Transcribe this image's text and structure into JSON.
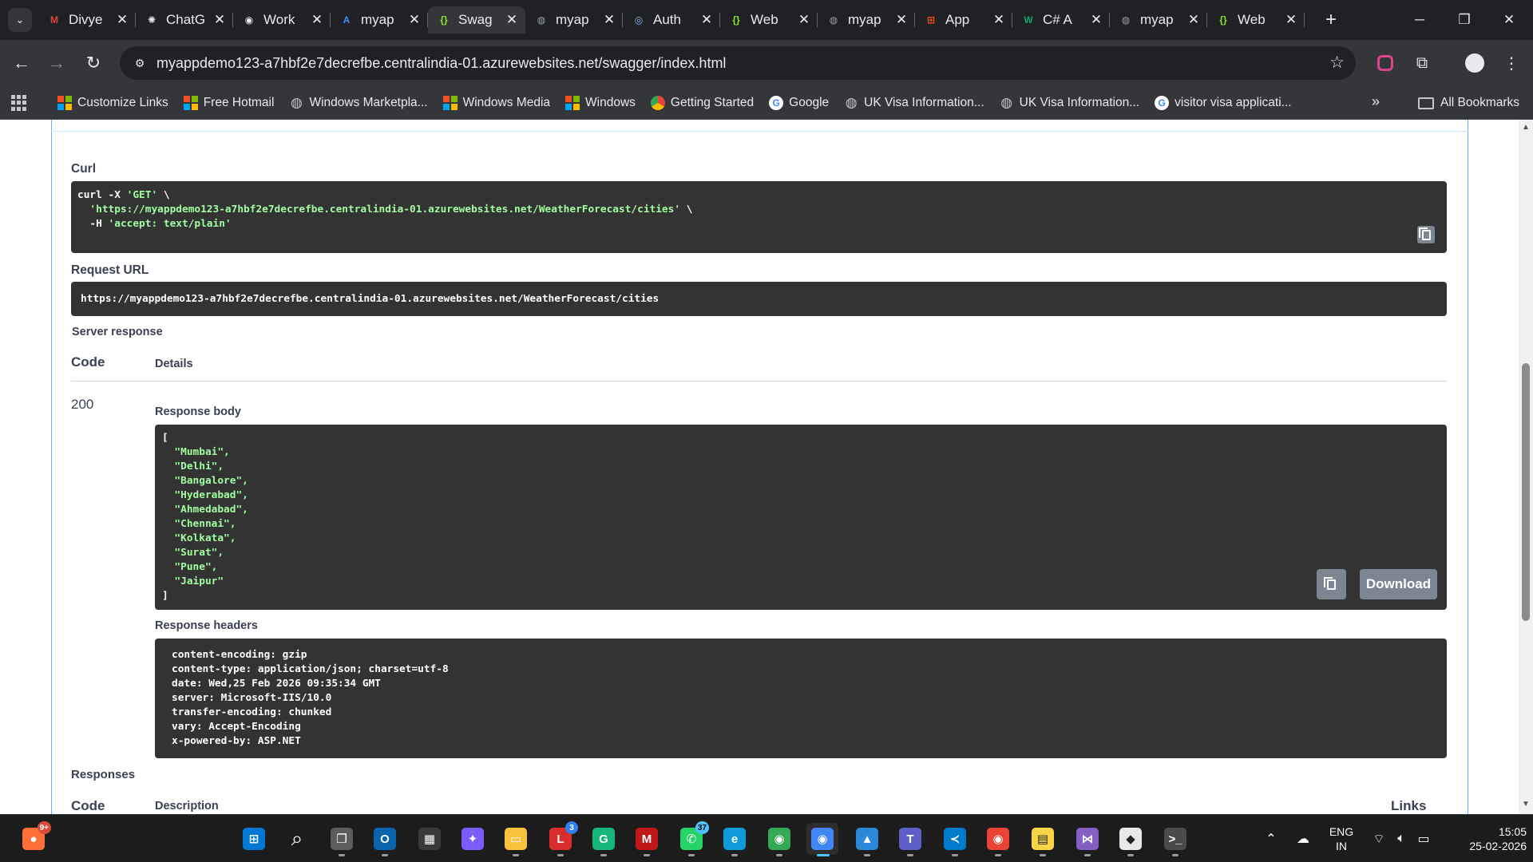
{
  "browser": {
    "tabs": [
      {
        "title": "Divye",
        "icon": "gmail-icon",
        "color": "#ea4335",
        "letter": "M"
      },
      {
        "title": "ChatG",
        "icon": "chatgpt-icon",
        "color": "#e8eaed",
        "letter": "✺"
      },
      {
        "title": "Work",
        "icon": "github-icon",
        "color": "#e8eaed",
        "letter": "◉"
      },
      {
        "title": "myap",
        "icon": "azure-icon",
        "color": "#3c8dff",
        "letter": "A"
      },
      {
        "title": "Swag",
        "icon": "swagger-icon",
        "color": "#85ea2d",
        "letter": "{}",
        "active": true
      },
      {
        "title": "myap",
        "icon": "globe-icon",
        "color": "#9aa0a6",
        "letter": "◍"
      },
      {
        "title": "Auth",
        "icon": "auth-icon",
        "color": "#8ab4f8",
        "letter": "◎"
      },
      {
        "title": "Web",
        "icon": "swagger-icon",
        "color": "#85ea2d",
        "letter": "{}"
      },
      {
        "title": "myap",
        "icon": "globe-icon",
        "color": "#9aa0a6",
        "letter": "◍"
      },
      {
        "title": "App",
        "icon": "microsoft-icon",
        "color": "#f25022",
        "letter": "⊞"
      },
      {
        "title": "C# A",
        "icon": "w3schools-icon",
        "color": "#04aa6d",
        "letter": "W"
      },
      {
        "title": "myap",
        "icon": "globe-icon",
        "color": "#9aa0a6",
        "letter": "◍"
      },
      {
        "title": "Web",
        "icon": "swagger-icon",
        "color": "#85ea2d",
        "letter": "{}"
      }
    ],
    "url": "myappdemo123-a7hbf2e7decrefbe.centralindia-01.azurewebsites.net/swagger/index.html",
    "bookmarks": [
      {
        "label": "Customize Links",
        "icon": "microsoft-icon"
      },
      {
        "label": "Free Hotmail",
        "icon": "microsoft-icon"
      },
      {
        "label": "Windows Marketpla...",
        "icon": "globe-icon"
      },
      {
        "label": "Windows Media",
        "icon": "microsoft-icon"
      },
      {
        "label": "Windows",
        "icon": "microsoft-icon"
      },
      {
        "label": "Getting Started",
        "icon": "chrome-icon"
      },
      {
        "label": "Google",
        "icon": "google-icon"
      },
      {
        "label": "UK Visa Information...",
        "icon": "globe-icon"
      },
      {
        "label": "UK Visa Information...",
        "icon": "globe-icon"
      },
      {
        "label": "visitor visa applicati...",
        "icon": "google-icon"
      }
    ],
    "all_bookmarks_label": "All Bookmarks"
  },
  "swagger": {
    "curl_label": "Curl",
    "curl_lines": [
      {
        "plain": "curl -X ",
        "str": "'GET'",
        "tail": " \\"
      },
      {
        "plain": "  ",
        "str": "'https://myappdemo123-a7hbf2e7decrefbe.centralindia-01.azurewebsites.net/WeatherForecast/cities'",
        "tail": " \\"
      },
      {
        "plain": "  -H ",
        "str": "'accept: text/plain'",
        "tail": ""
      }
    ],
    "request_url_label": "Request URL",
    "request_url": "https://myappdemo123-a7hbf2e7decrefbe.centralindia-01.azurewebsites.net/WeatherForecast/cities",
    "server_response_label": "Server response",
    "code_header": "Code",
    "details_header": "Details",
    "response_code": "200",
    "response_body_label": "Response body",
    "response_body": {
      "open": "[",
      "items": [
        "\"Mumbai\",",
        "\"Delhi\",",
        "\"Bangalore\",",
        "\"Hyderabad\",",
        "\"Ahmedabad\",",
        "\"Chennai\",",
        "\"Kolkata\",",
        "\"Surat\",",
        "\"Pune\",",
        "\"Jaipur\""
      ],
      "close": "]"
    },
    "download_label": "Download",
    "response_headers_label": "Response headers",
    "response_headers": [
      "content-encoding: gzip",
      "content-type: application/json; charset=utf-8",
      "date: Wed,25 Feb 2026 09:35:34 GMT",
      "server: Microsoft-IIS/10.0",
      "transfer-encoding: chunked",
      "vary: Accept-Encoding",
      "x-powered-by: ASP.NET"
    ],
    "responses_label": "Responses",
    "responses_code_header": "Code",
    "responses_description_header": "Description",
    "responses_links_header": "Links"
  },
  "taskbar": {
    "apps": [
      {
        "name": "firefox-icon",
        "color": "#ff7139",
        "glyph": "●",
        "badge": "9+"
      },
      {
        "name": "start-icon",
        "color": "#0078d4",
        "glyph": "⊞"
      },
      {
        "name": "search-icon",
        "color": "transparent",
        "glyph": "⌕"
      },
      {
        "name": "task-view-icon",
        "color": "#5c5c5c",
        "glyph": "❐"
      },
      {
        "name": "outlook-icon",
        "color": "#0a64ad",
        "glyph": "O"
      },
      {
        "name": "store-icon",
        "color": "#3a3a3a",
        "glyph": "▦"
      },
      {
        "name": "copilot-icon",
        "color": "#7b5cff",
        "glyph": "✦"
      },
      {
        "name": "file-explorer-icon",
        "color": "#f8c23c",
        "glyph": "▭"
      },
      {
        "name": "lens-icon",
        "color": "#d92d2d",
        "glyph": "L",
        "badge": "3"
      },
      {
        "name": "grammarly-icon",
        "color": "#15b67a",
        "glyph": "G"
      },
      {
        "name": "mcafee-icon",
        "color": "#c01818",
        "glyph": "M"
      },
      {
        "name": "whatsapp-icon",
        "color": "#25d366",
        "glyph": "✆",
        "badge": "37"
      },
      {
        "name": "edge-icon",
        "color": "#0f9bd7",
        "glyph": "e"
      },
      {
        "name": "chrome-icon",
        "color": "#34a853",
        "glyph": "◉"
      },
      {
        "name": "chrome-dev-icon",
        "color": "#4285f4",
        "glyph": "◉",
        "active": true
      },
      {
        "name": "photos-icon",
        "color": "#2b88d8",
        "glyph": "▲"
      },
      {
        "name": "teams-icon",
        "color": "#5b5fc7",
        "glyph": "T"
      },
      {
        "name": "vscode-icon",
        "color": "#007acc",
        "glyph": "≺"
      },
      {
        "name": "chrome-profile-icon",
        "color": "#ea4335",
        "glyph": "◉"
      },
      {
        "name": "sticky-notes-icon",
        "color": "#f7d547",
        "glyph": "▤"
      },
      {
        "name": "visual-studio-icon",
        "color": "#865fc5",
        "glyph": "⋈"
      },
      {
        "name": "box-app-icon",
        "color": "#e8e8e8",
        "glyph": "◆"
      },
      {
        "name": "terminal-icon",
        "color": "#4a4a4a",
        "glyph": ">_"
      }
    ],
    "lang_top": "ENG",
    "lang_bottom": "IN",
    "time": "15:05",
    "date": "25-02-2026"
  }
}
